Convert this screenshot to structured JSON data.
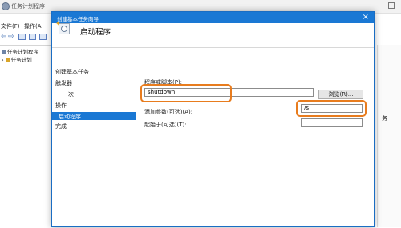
{
  "background_window": {
    "title": "任务计划程序",
    "menu": [
      "文件(F)",
      "操作(A"
    ],
    "tree": [
      "任务计划程序",
      "任务计划"
    ],
    "right_text": "务"
  },
  "dialog": {
    "title": "创建基本任务向导",
    "close_glyph": "×",
    "header": "启动程序",
    "nav": {
      "create_basic_task": "创建基本任务",
      "trigger": "触发器",
      "once": "一次",
      "action": "操作",
      "start_program": "启动程序",
      "finish": "完成"
    },
    "program_label": "程序或脚本(P):",
    "program_value": "shutdown",
    "browse_label": "浏览(R)...",
    "args_label": "添加参数(可选)(A):",
    "args_value": "/s",
    "start_in_label": "起始于(可选)(T):",
    "start_in_value": ""
  },
  "colors": {
    "accent": "#1a78d4",
    "highlight": "#e87c1e"
  }
}
